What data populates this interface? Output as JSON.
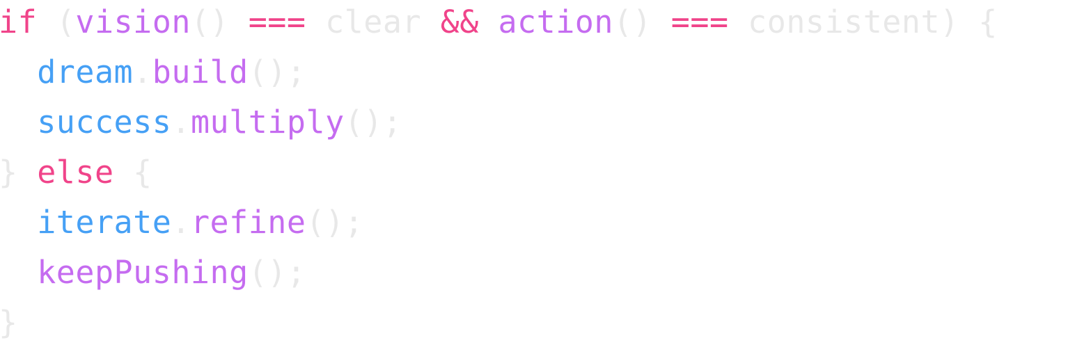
{
  "colors": {
    "keyword": "#f0448a",
    "function": "#c56cf0",
    "object": "#46a0f5",
    "muted": "#e8e8e8"
  },
  "lines": [
    {
      "tokens": [
        {
          "text": "if",
          "role": "keyword"
        },
        {
          "text": " (",
          "role": "muted"
        },
        {
          "text": "vision",
          "role": "function"
        },
        {
          "text": "() ",
          "role": "muted"
        },
        {
          "text": "===",
          "role": "keyword"
        },
        {
          "text": " clear ",
          "role": "muted"
        },
        {
          "text": "&&",
          "role": "keyword"
        },
        {
          "text": " ",
          "role": "muted"
        },
        {
          "text": "action",
          "role": "function"
        },
        {
          "text": "() ",
          "role": "muted"
        },
        {
          "text": "===",
          "role": "keyword"
        },
        {
          "text": " consistent) {",
          "role": "muted"
        }
      ]
    },
    {
      "tokens": [
        {
          "text": "  ",
          "role": "muted"
        },
        {
          "text": "dream",
          "role": "object"
        },
        {
          "text": ".",
          "role": "muted"
        },
        {
          "text": "build",
          "role": "function"
        },
        {
          "text": "();",
          "role": "muted"
        }
      ]
    },
    {
      "tokens": [
        {
          "text": "  ",
          "role": "muted"
        },
        {
          "text": "success",
          "role": "object"
        },
        {
          "text": ".",
          "role": "muted"
        },
        {
          "text": "multiply",
          "role": "function"
        },
        {
          "text": "();",
          "role": "muted"
        }
      ]
    },
    {
      "tokens": [
        {
          "text": "} ",
          "role": "muted"
        },
        {
          "text": "else",
          "role": "keyword"
        },
        {
          "text": " {",
          "role": "muted"
        }
      ]
    },
    {
      "tokens": [
        {
          "text": "  ",
          "role": "muted"
        },
        {
          "text": "iterate",
          "role": "object"
        },
        {
          "text": ".",
          "role": "muted"
        },
        {
          "text": "refine",
          "role": "function"
        },
        {
          "text": "();",
          "role": "muted"
        }
      ]
    },
    {
      "tokens": [
        {
          "text": "  ",
          "role": "muted"
        },
        {
          "text": "keepPushing",
          "role": "function"
        },
        {
          "text": "();",
          "role": "muted"
        }
      ]
    },
    {
      "tokens": [
        {
          "text": "}",
          "role": "muted"
        }
      ]
    }
  ]
}
